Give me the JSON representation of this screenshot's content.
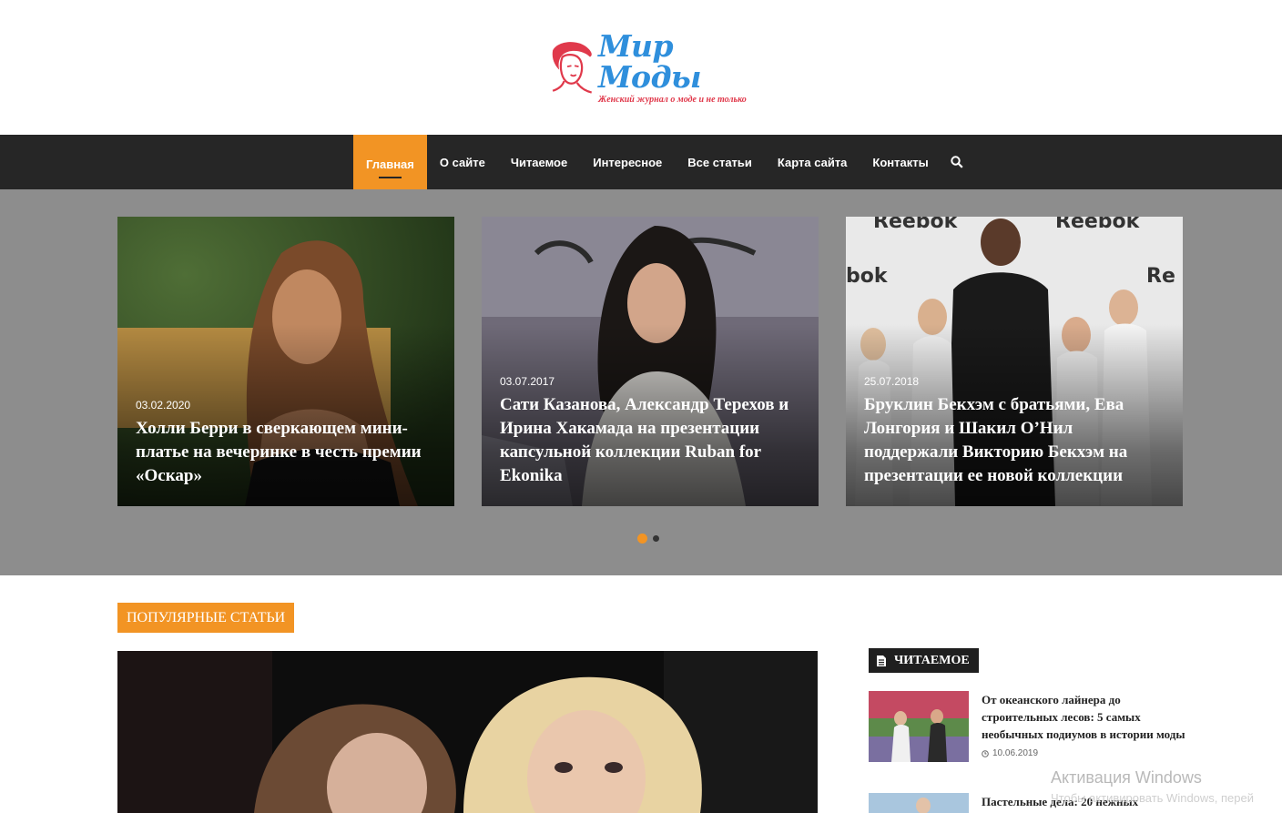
{
  "header": {
    "logo_title": "Мир Моды",
    "logo_tagline": "Женский журнал о моде и не только"
  },
  "nav": {
    "items": [
      {
        "label": "Главная",
        "active": true
      },
      {
        "label": "О сайте"
      },
      {
        "label": "Читаемое"
      },
      {
        "label": "Интересное"
      },
      {
        "label": "Все статьи"
      },
      {
        "label": "Карта сайта"
      },
      {
        "label": "Контакты"
      }
    ],
    "search_icon": "search-icon"
  },
  "slider": {
    "slides": [
      {
        "date": "03.02.2020",
        "title": "Холли Берри в сверкающем мини-платье на вечеринке в честь премии «Оскар»"
      },
      {
        "date": "03.07.2017",
        "title": "Сати Казанова, Александр Терехов и Ирина Хакамада на презентации капсульной коллекции Ruban for Ekonika"
      },
      {
        "date": "25.07.2018",
        "title": "Бруклин Бекхэм с братьями, Ева Лонгория и Шакил О’Нил поддержали Викторию Бекхэм на презентации ее новой коллекции"
      }
    ],
    "active_dot": 0
  },
  "popular_section": {
    "label": "ПОПУЛЯРНЫЕ СТАТЬИ"
  },
  "sidebar": {
    "widget_title": "ЧИТАЕМОЕ",
    "items": [
      {
        "title": "От океанского лайнера до строительных лесов: 5 самых необычных подиумов в истории моды",
        "date": "10.06.2019"
      },
      {
        "title": "Пастельные дела: 20 нежных"
      }
    ]
  },
  "watermark": {
    "line1": "Активация Windows",
    "line2": "Чтобы активировать Windows, перей"
  },
  "colors": {
    "accent": "#f29424",
    "nav_bg": "#262626",
    "slider_bg": "#8d8d8d",
    "logo_blue": "#2f8fdc",
    "logo_red": "#e0394b"
  }
}
